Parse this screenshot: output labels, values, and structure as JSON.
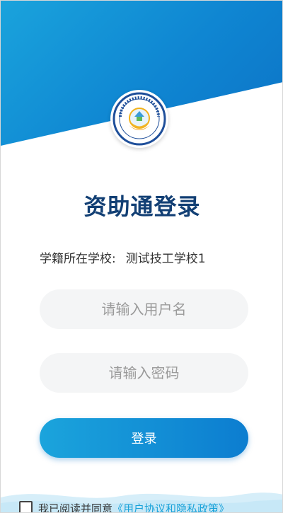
{
  "page": {
    "title": "资助通登录",
    "school_label": "学籍所在学校:",
    "school_name": "测试技工学校1"
  },
  "form": {
    "username_placeholder": "请输入用户名",
    "password_placeholder": "请输入密码",
    "login_label": "登录"
  },
  "agreement": {
    "prefix": "我已阅读并同意",
    "link": "《用户协议和隐私政策》",
    "checked": false
  },
  "colors": {
    "brand_blue": "#0f86d2",
    "title": "#123f74",
    "link": "#19a2d9"
  }
}
